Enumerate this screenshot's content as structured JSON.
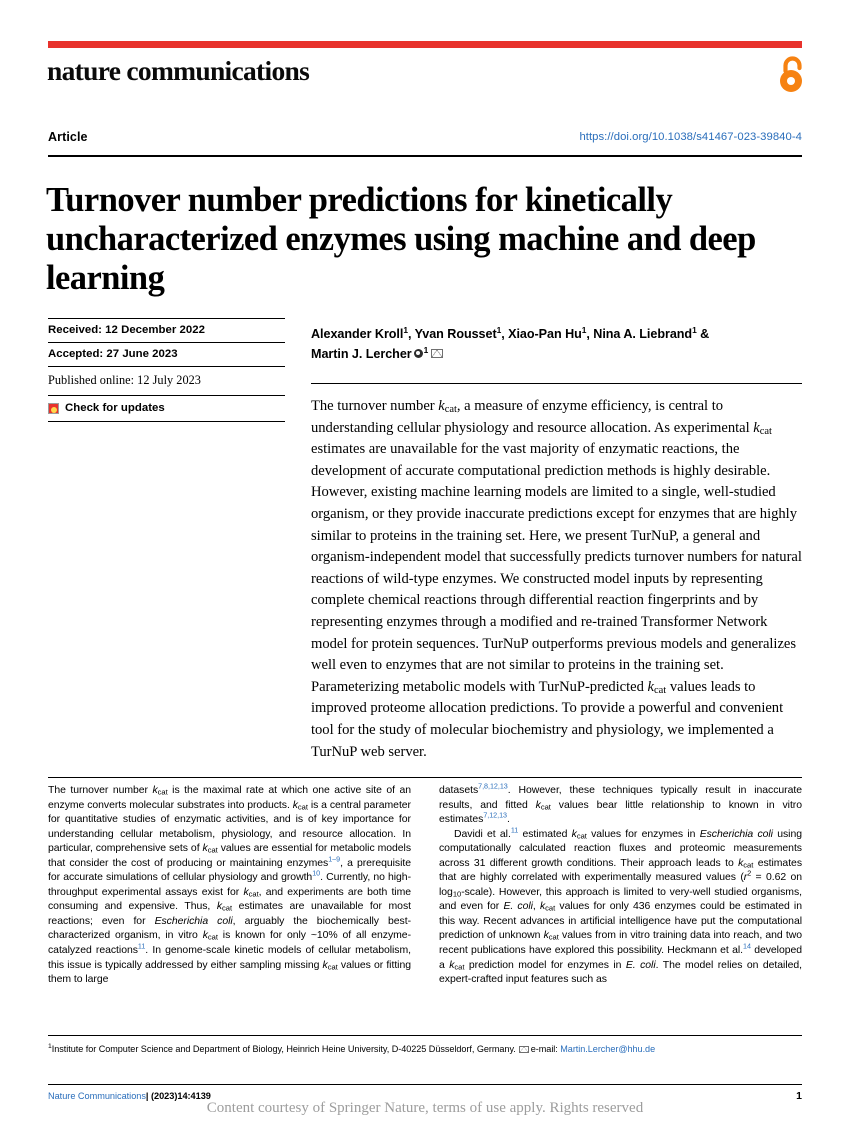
{
  "journal": {
    "masthead": "nature communications",
    "bar_color": "#e8322c",
    "open_access_icon": "open-access-lock-icon"
  },
  "header": {
    "article_label": "Article",
    "doi": "https://doi.org/10.1038/s41467-023-39840-4",
    "doi_color": "#2a6ebb"
  },
  "title": "Turnover number predictions for kinetically uncharacterized enzymes using machine and deep learning",
  "meta": {
    "received": "Received: 12 December 2022",
    "accepted": "Accepted: 27 June 2023",
    "published": "Published online: 12 July 2023",
    "check_updates": "Check for updates"
  },
  "authors": {
    "line1_pre": "Alexander Kroll",
    "a1": "1",
    "sep1": ", Yvan Rousset",
    "a2": "1",
    "sep2": ", Xiao-Pan Hu",
    "a3": "1",
    "sep3": ", Nina A. Liebrand",
    "a4": "1",
    "amp": " &",
    "line2": "Martin J. Lercher",
    "a5": "1"
  },
  "abstract": {
    "p1_a": "The turnover number ",
    "k1": "k",
    "k1sub": "cat",
    "p1_b": ", a measure of enzyme efficiency, is central to understanding cellular physiology and resource allocation. As experimental ",
    "k2": "k",
    "k2sub": "cat",
    "p1_c": " estimates are unavailable for the vast majority of enzymatic reactions, the development of accurate computational prediction methods is highly desirable. However, existing machine learning models are limited to a single, well-studied organism, or they provide inaccurate predictions except for enzymes that are highly similar to proteins in the training set. Here, we present TurNuP, a general and organism-independent model that successfully predicts turnover numbers for natural reactions of wild-type enzymes. We constructed model inputs by representing complete chemical reactions through differential reaction fingerprints and by representing enzymes through a modified and re-trained Transformer Network model for protein sequences. TurNuP outperforms previous models and generalizes well even to enzymes that are not similar to proteins in the training set. Parameterizing metabolic models with TurNuP-predicted ",
    "k3": "k",
    "k3sub": "cat",
    "p1_d": " values leads to improved proteome allocation predictions. To provide a powerful and convenient tool for the study of molecular biochemistry and physiology, we implemented a TurNuP web server."
  },
  "body": {
    "left": {
      "s1": "The turnover number ",
      "k1": "k",
      "k1sub": "cat",
      "s2": " is the maximal rate at which one active site of an enzyme converts molecular substrates into products. ",
      "k2": "k",
      "k2sub": "cat",
      "s3": " is a central parameter for quantitative studies of enzymatic activities, and is of key importance for understanding cellular metabolism, physiology, and resource allocation. In particular, comprehensive sets of ",
      "k3": "k",
      "k3sub": "cat",
      "s4": " values are essential for metabolic models that consider the cost of producing or maintaining enzymes",
      "ref1": "1–9",
      "s5": ", a prerequisite for accurate simulations of cellular physiology and growth",
      "ref2": "10",
      "s6": ". Currently, no high-throughput experimental assays exist for ",
      "k4": "k",
      "k4sub": "cat",
      "s7": ", and experiments are both time consuming and expensive. Thus, ",
      "k5": "k",
      "k5sub": "cat",
      "s8": " estimates are unavailable for most reactions; even for ",
      "org1": "Escherichia coli",
      "s9": ", arguably the biochemically best-characterized organism, in vitro ",
      "k6": "k",
      "k6sub": "cat",
      "s10": " is known for only ~10% of all enzyme-catalyzed reactions",
      "ref3": "11",
      "s11": ". In genome-scale kinetic models of cellular metabolism, this issue is typically addressed by either sampling missing ",
      "k7": "k",
      "k7sub": "cat",
      "s12": " values or fitting them to large"
    },
    "right": {
      "s1": "datasets",
      "ref1": "7,8,12,13",
      "s2": ". However, these techniques typically result in inaccurate results, and fitted ",
      "k1": "k",
      "k1sub": "cat",
      "s3": " values bear little relationship to known in vitro estimates",
      "ref2": "7,12,13",
      "s4": ".",
      "p2_s1": "Davidi et al.",
      "p2_ref1": "11",
      "p2_s2": " estimated ",
      "p2_k1": "k",
      "p2_k1sub": "cat",
      "p2_s3": " values for enzymes in ",
      "p2_org1": "Escherichia coli",
      "p2_s4": " using computationally calculated reaction fluxes and proteomic measurements across 31 different growth conditions. Their approach leads to ",
      "p2_k2": "k",
      "p2_k2sub": "cat",
      "p2_s5": " estimates that are highly correlated with experimentally measured values (",
      "p2_r2": "r",
      "p2_r2sup": "2",
      "p2_s6": " = 0.62 on log",
      "p2_logsub": "10",
      "p2_s7": "-scale). However, this approach is limited to very-well studied organisms, and even for ",
      "p2_org2": "E. coli",
      "p2_s8": ", ",
      "p2_k3": "k",
      "p2_k3sub": "cat",
      "p2_s9": " values for only 436 enzymes could be estimated in this way. Recent advances in artificial intelligence have put the computational prediction of unknown ",
      "p2_k4": "k",
      "p2_k4sub": "cat",
      "p2_s10": " values from in vitro training data into reach, and two recent publications have explored this possibility. Heckmann et al.",
      "p2_ref2": "14",
      "p2_s11": " developed a ",
      "p2_k5": "k",
      "p2_k5sub": "cat",
      "p2_s12": " prediction model for enzymes in ",
      "p2_org3": "E. coli",
      "p2_s13": ". The model relies on detailed, expert-crafted input features such as"
    }
  },
  "affiliation": {
    "marker": "1",
    "text": "Institute for Computer Science and Department of Biology, Heinrich Heine University, D-40225 Düsseldorf, Germany. ",
    "email_label": "e-mail: ",
    "email": "Martin.Lercher@hhu.de"
  },
  "footer": {
    "journal": "Nature Communications",
    "citation": "| (2023)14:4139",
    "page": "1",
    "watermark": "Content courtesy of Springer Nature, terms of use apply. Rights reserved"
  }
}
